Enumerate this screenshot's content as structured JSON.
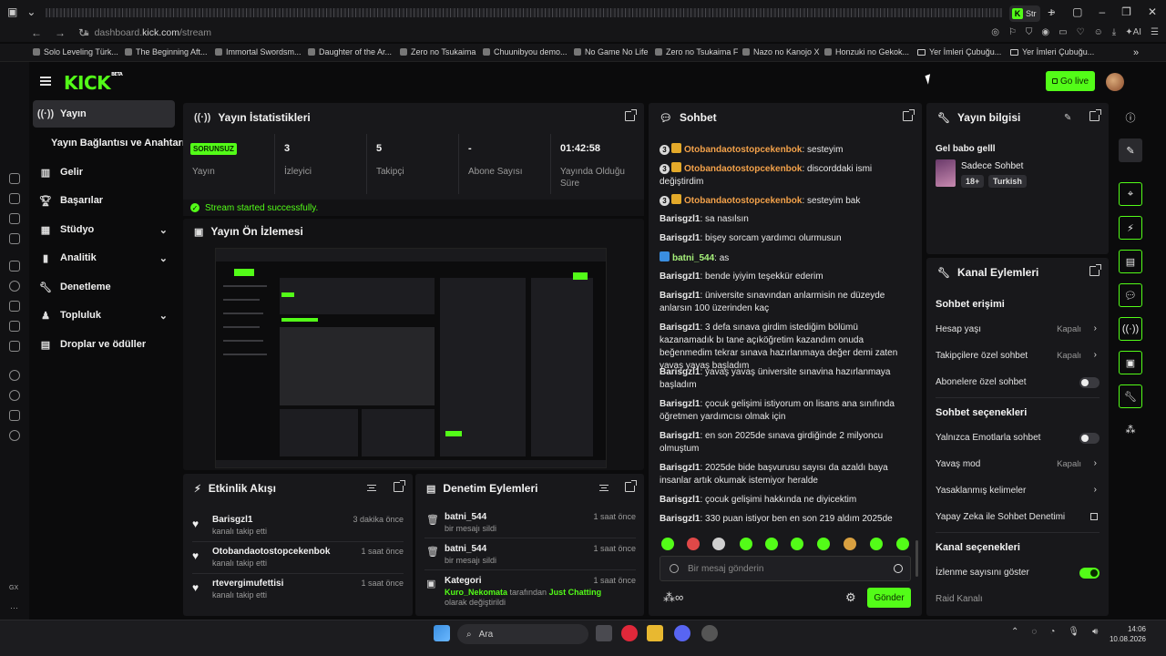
{
  "browser": {
    "active_tab": "Str",
    "url_prefix": "dashboard.",
    "url_domain": "kick.com",
    "url_path": "/stream",
    "bookmarks": [
      "Solo Leveling Türk...",
      "The Beginning Aft...",
      "Immortal Swordsm...",
      "Daughter of the Ar...",
      "Zero no Tsukaima",
      "Chuunibyou demo...",
      "No Game No Life",
      "Zero no Tsukaima F",
      "Nazo no Kanojo X",
      "Honzuki no Gekok...",
      "Yer İmleri Çubuğu...",
      "Yer İmleri Çubuğu..."
    ]
  },
  "header": {
    "logo": "KICK",
    "logo_tag": "BETA",
    "go_live": "Go live"
  },
  "nav": {
    "items": [
      {
        "label": "Yayın",
        "icon": "stream-icon"
      },
      {
        "label": "Yayın Bağlantısı ve Anahtarı",
        "icon": ""
      },
      {
        "label": "Gelir",
        "icon": "chart-icon"
      },
      {
        "label": "Başarılar",
        "icon": "trophy-icon"
      },
      {
        "label": "Stüdyo",
        "icon": "grid-icon"
      },
      {
        "label": "Analitik",
        "icon": "analytics-icon"
      },
      {
        "label": "Denetleme",
        "icon": "wrench-icon"
      },
      {
        "label": "Topluluk",
        "icon": "community-icon"
      },
      {
        "label": "Droplar ve ödüller",
        "icon": "gift-icon"
      }
    ]
  },
  "stats": {
    "title": "Yayın İstatistikleri",
    "status": "SORUNSUZ",
    "cells": [
      {
        "value": "",
        "label": "Yayın"
      },
      {
        "value": "3",
        "label": "İzleyici"
      },
      {
        "value": "5",
        "label": "Takipçi"
      },
      {
        "value": "-",
        "label": "Abone Sayısı"
      },
      {
        "value": "01:42:58",
        "label": "Yayında Olduğu Süre"
      }
    ],
    "success": "Stream started successfully."
  },
  "preview": {
    "title": "Yayın Ön İzlemesi"
  },
  "activity": {
    "title": "Etkinlik Akışı",
    "items": [
      {
        "name": "Barisgzl1",
        "sub": "kanalı takip etti",
        "time": "3 dakika önce"
      },
      {
        "name": "Otobandaotostopcekenbok",
        "sub": "kanalı takip etti",
        "time": "1 saat önce"
      },
      {
        "name": "rtevergimufettisi",
        "sub": "kanalı takip etti",
        "time": "1 saat önce"
      }
    ]
  },
  "moderation": {
    "title": "Denetim Eylemleri",
    "items": [
      {
        "name": "batni_544",
        "sub": "bir mesajı sildi",
        "time": "1 saat önce"
      },
      {
        "name": "batni_544",
        "sub": "bir mesajı sildi",
        "time": "1 saat önce"
      },
      {
        "name": "Kategori",
        "sub_user": "Kuro_Nekomata",
        "sub_mid": " tarafından ",
        "sub_cat": "Just Chatting",
        "sub_end": " olarak değiştirildi",
        "time": "1 saat önce"
      }
    ]
  },
  "chat": {
    "title": "Sohbet",
    "messages": [
      {
        "user": "Otobandaotostopcekenbok",
        "text": "sesteyim",
        "style": "orange"
      },
      {
        "user": "Otobandaotostopcekenbok",
        "text": "discorddaki ismi değiştirdim",
        "style": "orange"
      },
      {
        "user": "Otobandaotostopcekenbok",
        "text": "sesteyim bak",
        "style": "orange"
      },
      {
        "user": "Barisgzl1",
        "text": "sa nasılsın",
        "style": "plain"
      },
      {
        "user": "Barisgzl1",
        "text": "bişey sorcam yardımcı olurmusun",
        "style": "plain"
      },
      {
        "user": "batni_544",
        "text": "as",
        "style": "green"
      },
      {
        "user": "Barisgzl1",
        "text": "bende iyiyim teşekkür ederim",
        "style": "plain"
      },
      {
        "user": "Barisgzl1",
        "text": "üniversite sınavından anlarmisin ne düzeyde anlarsın 100 üzerinden kaç",
        "style": "plain"
      },
      {
        "user": "Barisgzl1",
        "text": "3 defa sınava girdim istediğim bölümü kazanamadık bı tane açıköğretim kazandım onuda beğenmedim tekrar sınava hazırlanmaya değer demi zaten yavaş yavaş başladım",
        "style": "plain"
      },
      {
        "user": "Barisgzl1",
        "text": "yavaş yavaş üniversite sınavina hazırlanmaya başladım",
        "style": "plain"
      },
      {
        "user": "Barisgzl1",
        "text": "çocuk gelişimi istiyorum on lisans ana sınıfında öğretmen yardımcısı olmak için",
        "style": "plain"
      },
      {
        "user": "Barisgzl1",
        "text": "en son 2025de sınava girdiğinde 2 milyoncu olmuştum",
        "style": "plain"
      },
      {
        "user": "Barisgzl1",
        "text": "2025de bide başvurusu sayısı da azaldı baya insanlar artık okumak istemiyor heralde",
        "style": "plain"
      },
      {
        "user": "Barisgzl1",
        "text": "çocuk gelişimi hakkında ne diyicektim",
        "style": "plain"
      },
      {
        "user": "Barisgzl1",
        "text": "330 puan istiyor ben en son 219 aldım 2025de",
        "style": "plain"
      }
    ],
    "badge_count": "3",
    "input_placeholder": "Bir mesaj gönderin",
    "send": "Gönder"
  },
  "stream_info": {
    "title": "Yayın bilgisi",
    "stream_title": "Gel babo gelll",
    "category": "Sadece Sohbet",
    "tags": [
      "18+",
      "Turkish"
    ]
  },
  "channel_actions": {
    "title": "Kanal Eylemleri",
    "chat_access": "Sohbet erişimi",
    "account_age": {
      "label": "Hesap yaşı",
      "value": "Kapalı"
    },
    "followers_only": {
      "label": "Takipçilere özel sohbet",
      "value": "Kapalı"
    },
    "subs_only": {
      "label": "Abonelere özel sohbet",
      "on": false
    },
    "chat_options": "Sohbet seçenekleri",
    "emote_only": {
      "label": "Yalnızca Emotlarla sohbet",
      "on": false
    },
    "slow_mode": {
      "label": "Yavaş mod",
      "value": "Kapalı"
    },
    "banned_words": {
      "label": "Yasaklanmış kelimeler"
    },
    "ai_moderation": {
      "label": "Yapay Zeka ile Sohbet Denetimi"
    },
    "channel_options": "Kanal seçenekleri",
    "show_views": {
      "label": "İzlenme sayısını göster",
      "on": true
    },
    "raid": {
      "label": "Raid Kanalı"
    }
  },
  "taskbar": {
    "search": "Ara",
    "time": "14:06",
    "date": "10.08.2026"
  },
  "colors": {
    "accent": "#53fc18",
    "bg": "#0b0b0c",
    "panel": "#18181b"
  }
}
